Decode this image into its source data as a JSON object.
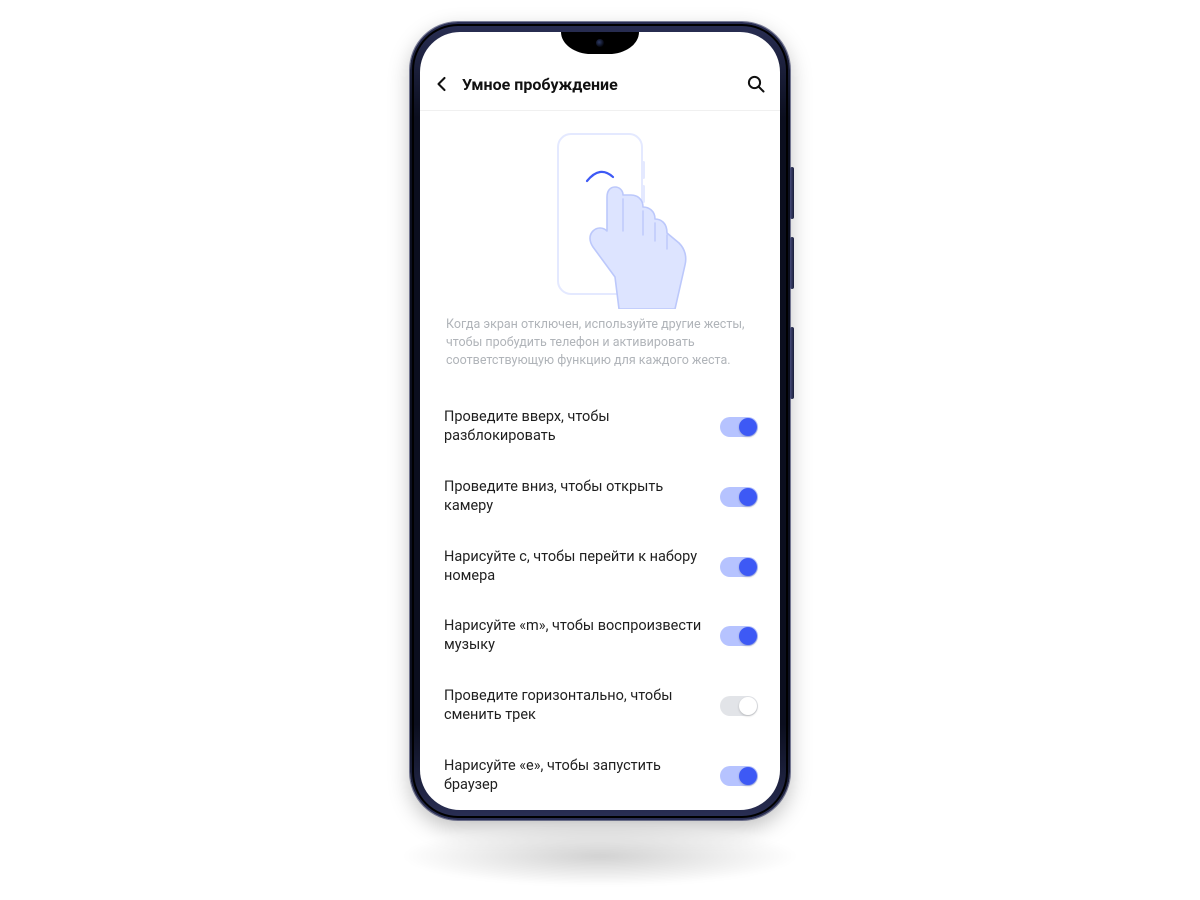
{
  "header": {
    "title": "Умное пробуждение",
    "back_icon": "chevron-left-icon",
    "search_icon": "search-icon"
  },
  "hero": {
    "description": "Когда экран отключен, используйте другие жесты, чтобы пробудить телефон и активировать соответствующую функцию для каждого жеста."
  },
  "settings": [
    {
      "label": "Проведите вверх, чтобы разблокировать",
      "on": true
    },
    {
      "label": "Проведите вниз, чтобы открыть камеру",
      "on": true
    },
    {
      "label": "Нарисуйте с, чтобы перейти к набору номера",
      "on": true
    },
    {
      "label": "Нарисуйте «m», чтобы воспроизвести музыку",
      "on": true
    },
    {
      "label": "Проведите горизонтально, чтобы сменить трек",
      "on": false
    },
    {
      "label": "Нарисуйте «e», чтобы запустить браузер",
      "on": true
    }
  ],
  "colors": {
    "accent": "#3d59f5",
    "accent_track": "#b6c3ff",
    "off_track": "#e2e4e8"
  }
}
